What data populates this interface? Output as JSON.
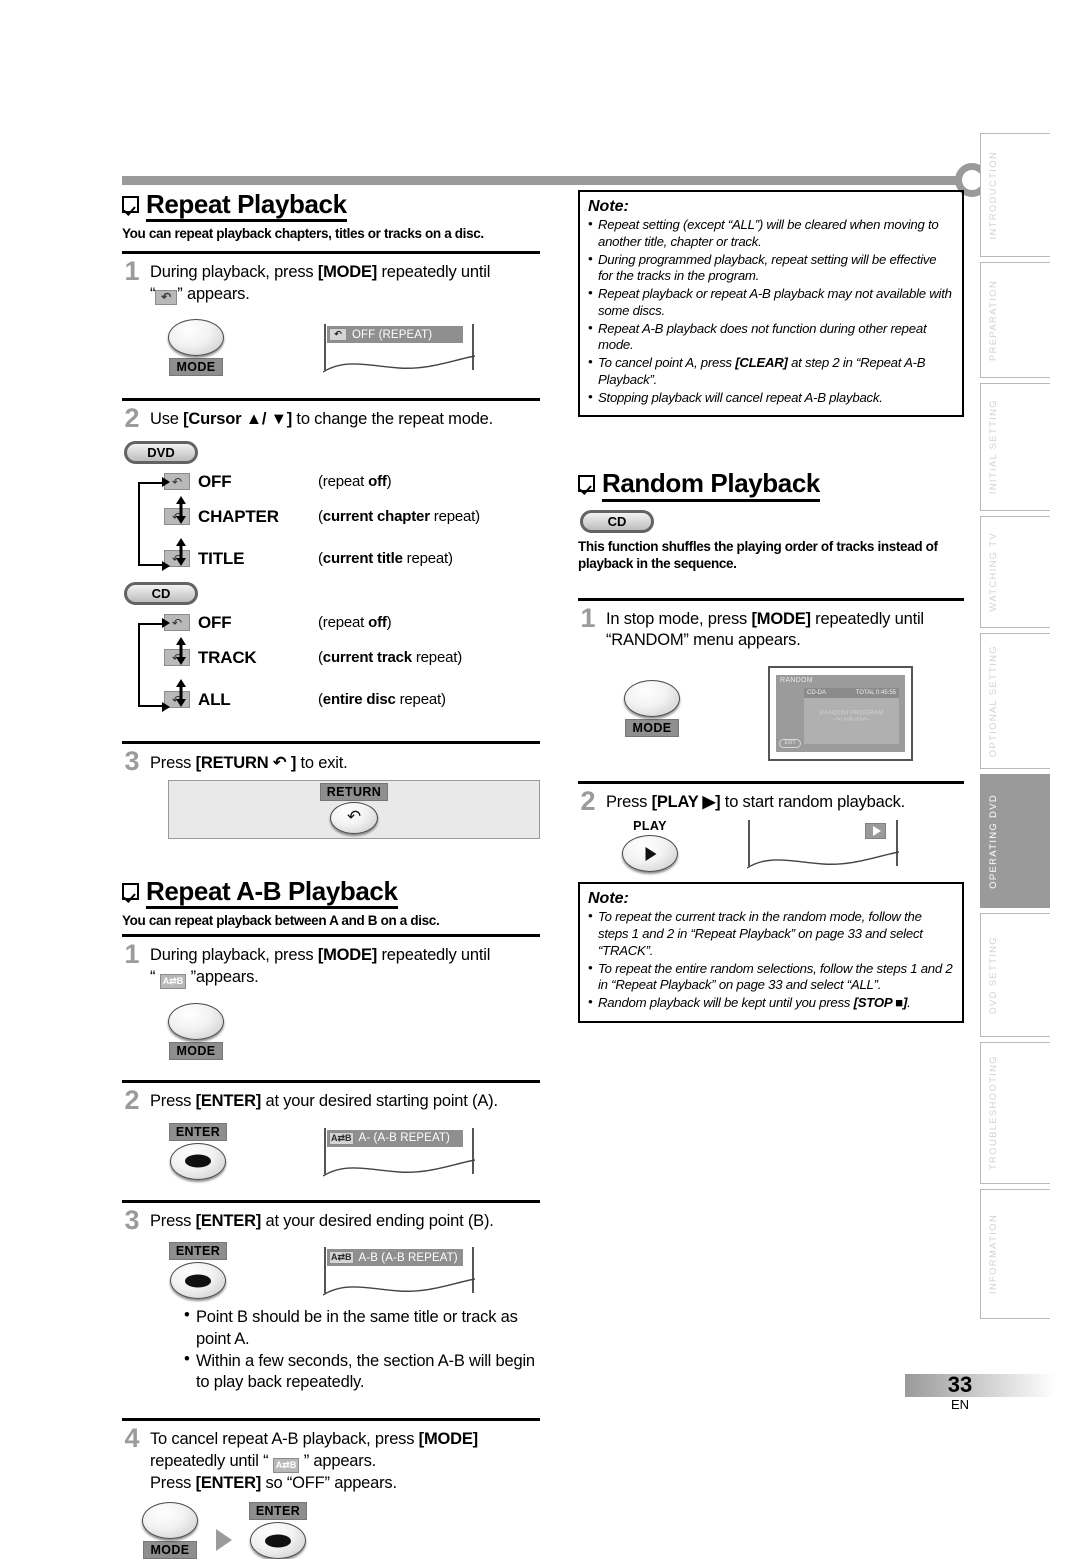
{
  "document": {
    "page_number": "33",
    "language_code": "EN"
  },
  "sidebar": {
    "tabs": [
      {
        "label": "INTRODUCTION",
        "active": false
      },
      {
        "label": "PREPARATION",
        "active": false
      },
      {
        "label": "INITIAL  SETTING",
        "active": false
      },
      {
        "label": "WATCHING  TV",
        "active": false
      },
      {
        "label": "OPTIONAL  SETTING",
        "active": false
      },
      {
        "label": "OPERATING  DVD",
        "active": true
      },
      {
        "label": "DVD  SETTING",
        "active": false
      },
      {
        "label": "TROUBLESHOOTING",
        "active": false
      },
      {
        "label": "INFORMATION",
        "active": false
      }
    ]
  },
  "repeat_playback": {
    "title": "Repeat Playback",
    "description": "You can repeat playback chapters, titles or tracks on a disc.",
    "step1": {
      "number": "1",
      "text_before": "During playback, press [MODE] repeatedly until “",
      "text_after": "” appears.",
      "button_label": "MODE",
      "osd": {
        "icon": "repeat-loop",
        "text": "OFF    (REPEAT)"
      }
    },
    "step2": {
      "number": "2",
      "text": "Use [Cursor ▲/ ▼] to change the repeat mode."
    },
    "dvd_badge": "DVD",
    "cd_badge": "CD",
    "dvd_modes": [
      {
        "label": "OFF",
        "note_bold": "",
        "note_plain": "(repeat ",
        "note_bold2": "off",
        "note_tail": ")"
      },
      {
        "label": "CHAPTER",
        "note": "(current chapter repeat)"
      },
      {
        "label": "TITLE",
        "note": "(current title repeat)"
      }
    ],
    "cd_modes": [
      {
        "label": "OFF",
        "note": "(repeat off)"
      },
      {
        "label": "TRACK",
        "note": "(current track repeat)"
      },
      {
        "label": "ALL",
        "note": "(entire disc repeat)"
      }
    ],
    "step3": {
      "number": "3",
      "text": "Press [RETURN ↶ ] to exit.",
      "button_label": "RETURN"
    }
  },
  "repeat_ab_playback": {
    "title": "Repeat A-B Playback",
    "description": "You can repeat playback between A and B on a disc.",
    "step1": {
      "number": "1",
      "text_before": "During playback, press [MODE] repeatedly until “",
      "text_after": "”appears.",
      "icon_label": "A⇄B",
      "button_label": "MODE"
    },
    "step2": {
      "number": "2",
      "text": "Press [ENTER] at your desired starting point (A).",
      "button_label": "ENTER",
      "osd": {
        "icon": "A⇄B",
        "text": "A-    (A-B REPEAT)"
      }
    },
    "step3": {
      "number": "3",
      "text": "Press [ENTER] at your desired ending point (B).",
      "button_label": "ENTER",
      "osd": {
        "icon": "A⇄B",
        "text": "A-B  (A-B REPEAT)"
      },
      "bullets": [
        "Point B should be in the same title or track as point A.",
        "Within a few seconds, the section A-B will begin to play back repeatedly."
      ]
    },
    "step4": {
      "number": "4",
      "line1_before": "To cancel repeat A-B playback, press [MODE] repeatedly until “",
      "line1_after": "” appears.",
      "line2": "Press [ENTER] so “OFF” appears.",
      "icon_label": "A⇄B",
      "mode_button_label": "MODE",
      "enter_button_label": "ENTER"
    }
  },
  "note_repeat": {
    "title": "Note:",
    "items": [
      "Repeat setting (except “ALL”) will be cleared when moving to another title, chapter or track.",
      "During programmed playback, repeat setting will be effective for the tracks in the program.",
      "Repeat playback or repeat A-B playback may not available with some discs.",
      "Repeat A-B playback does not function during other repeat mode.",
      "To cancel point A, press [CLEAR] at step 2 in “Repeat A-B Playback”.",
      "Stopping playback will cancel repeat A-B playback."
    ]
  },
  "random_playback": {
    "title": "Random Playback",
    "cd_badge": "CD",
    "description": "This function shuffles the playing order of tracks instead of playback in the sequence.",
    "step1": {
      "number": "1",
      "text": "In stop mode, press [MODE] repeatedly until “RANDOM” menu appears.",
      "button_label": "MODE",
      "screen": {
        "title": "RANDOM",
        "disc_type": "CD-DA",
        "total": "TOTAL 0:45:55",
        "center_line1": "RANDOM PROGRAM",
        "center_line2": "--no indication--",
        "exit_label": "EXIT"
      }
    },
    "step2": {
      "number": "2",
      "text": "Press [PLAY ▶] to start random playback.",
      "button_label": "PLAY"
    }
  },
  "note_random": {
    "title": "Note:",
    "items": [
      "To repeat the current track in the random mode, follow the steps 1 and 2 in “Repeat Playback” on page 33 and select “TRACK”.",
      "To repeat the entire random selections, follow the steps 1 and 2 in “Repeat Playback” on page 33 and select “ALL”.",
      "Random playback will be kept until you press [STOP ■]."
    ]
  }
}
